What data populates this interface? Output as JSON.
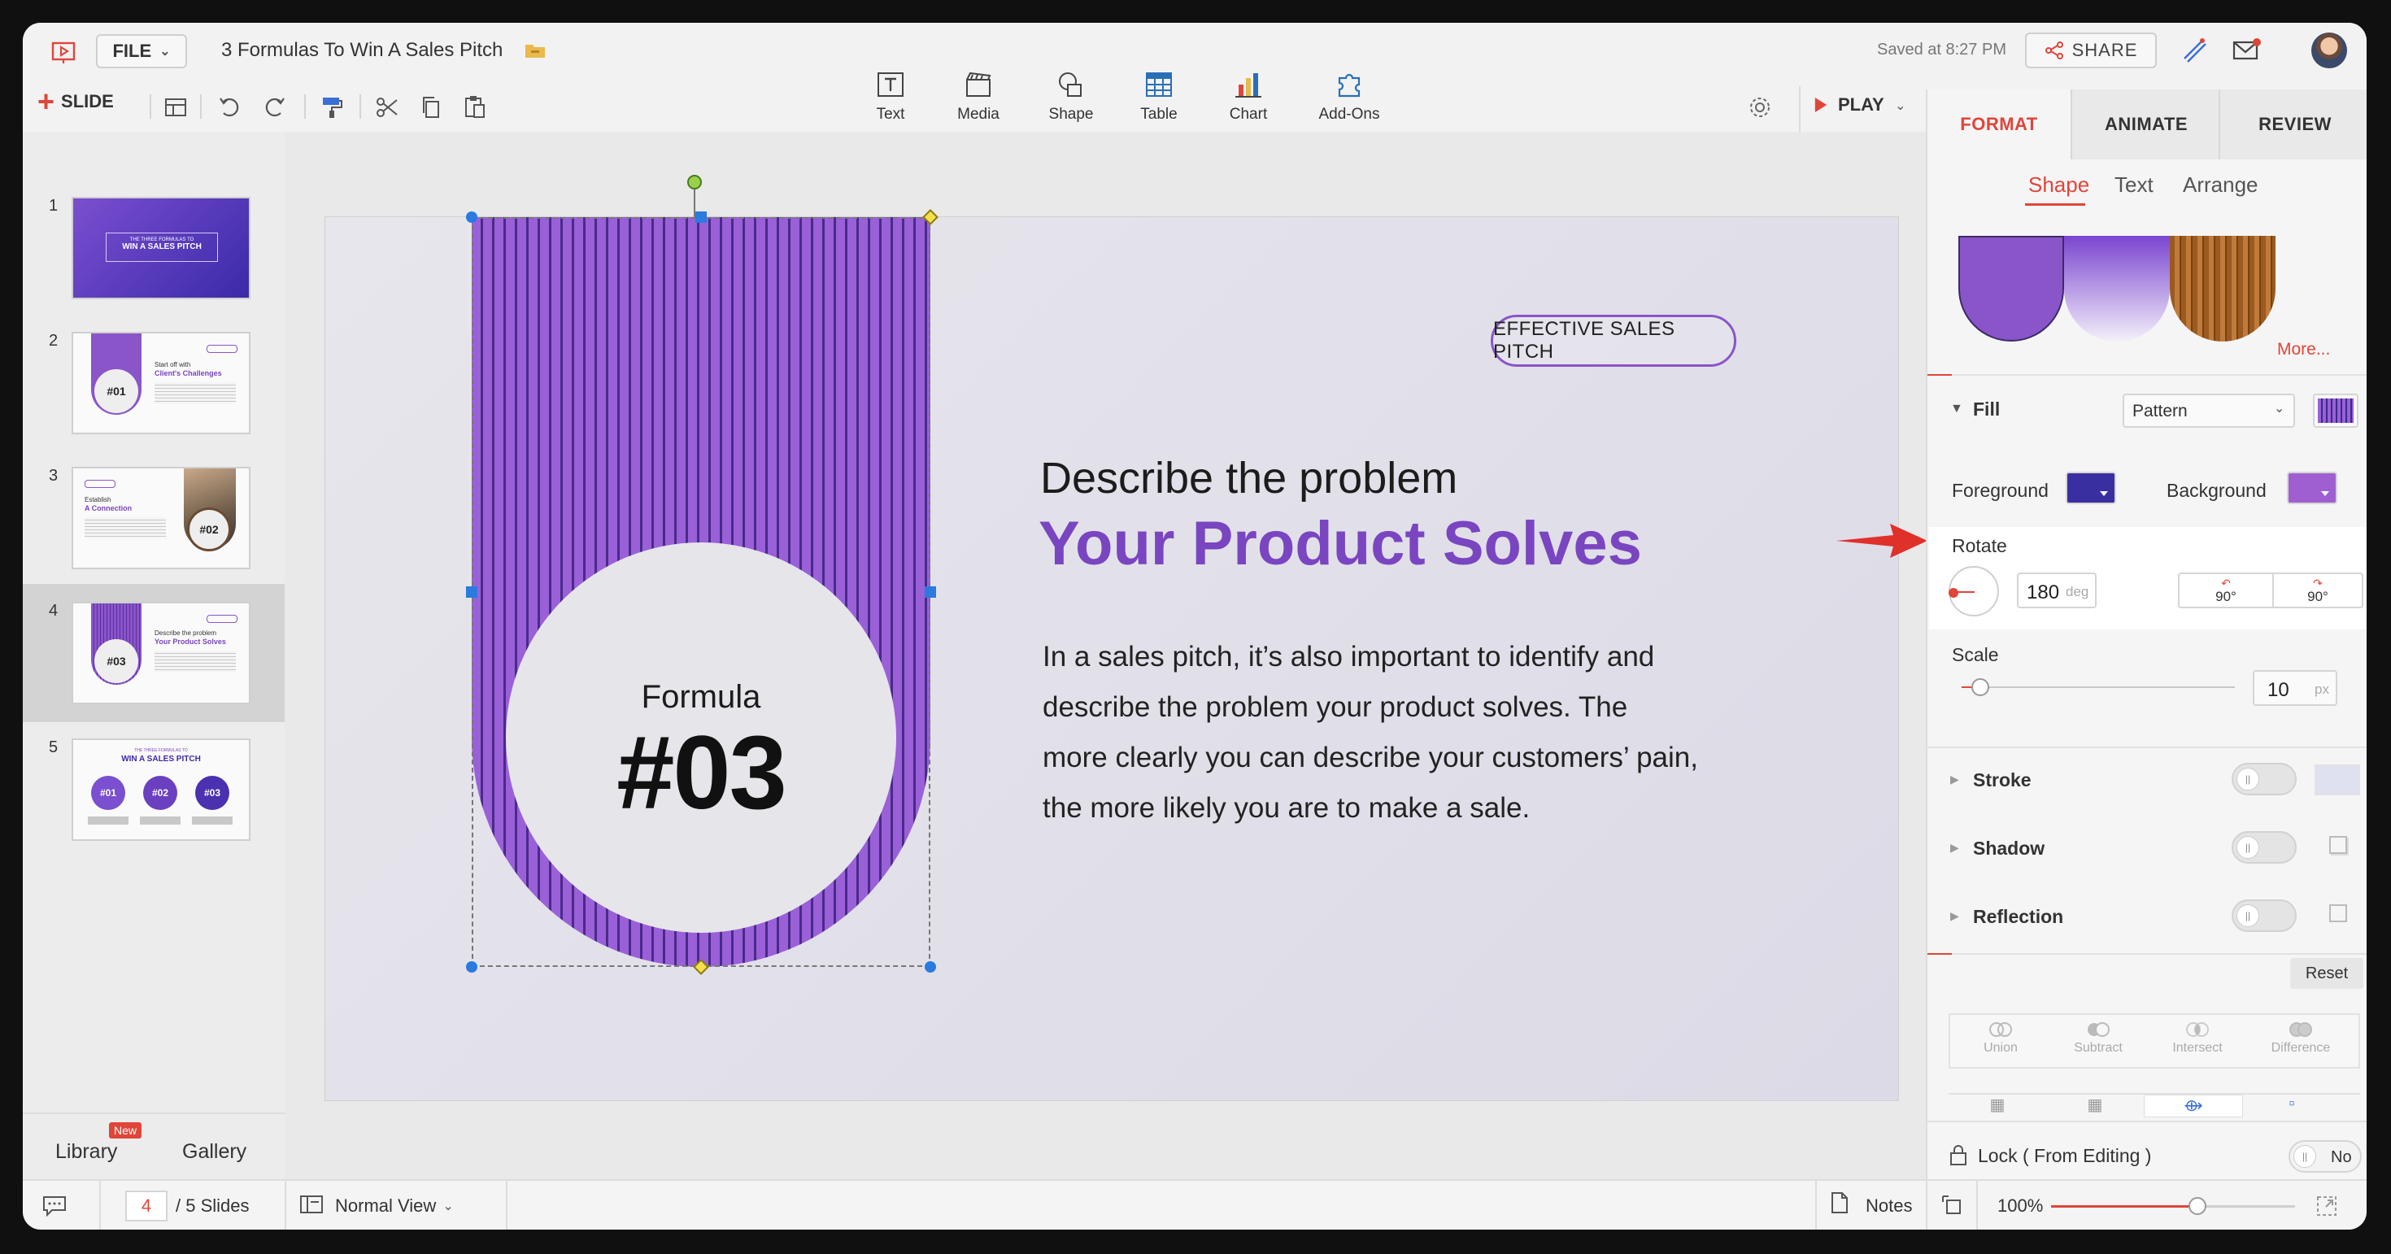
{
  "header": {
    "file_label": "FILE",
    "doc_title": "3 Formulas To Win A Sales Pitch",
    "saved_status": "Saved at 8:27 PM",
    "share_label": "SHARE",
    "play_label": "PLAY",
    "slide_label": "SLIDE"
  },
  "insert_tools": [
    {
      "label": "Text",
      "icon": "text-icon"
    },
    {
      "label": "Media",
      "icon": "media-icon"
    },
    {
      "label": "Shape",
      "icon": "shape-icon"
    },
    {
      "label": "Table",
      "icon": "table-icon"
    },
    {
      "label": "Chart",
      "icon": "chart-icon"
    },
    {
      "label": "Add-Ons",
      "icon": "addons-icon"
    }
  ],
  "slides_panel": {
    "numbers": [
      "1",
      "2",
      "3",
      "4",
      "5"
    ],
    "selected": 4,
    "thumb1": {
      "kicker": "THE THREE FORMULAS TO",
      "title": "WIN A SALES PITCH"
    },
    "thumb2": {
      "line1": "Start off with",
      "line2": "Client's Challenges",
      "badge": "#01"
    },
    "thumb3": {
      "line1": "Establish",
      "line2": "A Connection",
      "badge": "#02"
    },
    "thumb4": {
      "line1": "Describe the problem",
      "line2": "Your Product Solves",
      "badge": "#03"
    },
    "thumb5": {
      "kicker": "THE THREE FORMULAS TO",
      "title": "WIN A SALES PITCH",
      "b1": "#01",
      "b2": "#02",
      "b3": "#03"
    },
    "library_label": "Library",
    "library_badge": "New",
    "gallery_label": "Gallery"
  },
  "slide": {
    "tag": "EFFECTIVE SALES PITCH",
    "heading_line1": "Describe the problem",
    "heading_line2": "Your Product Solves",
    "body_lines": [
      "In a sales pitch, it’s also important to identify and",
      "describe the problem your product solves. The",
      "more clearly you can describe your customers’ pain,",
      "the more likely you are to make a sale."
    ],
    "formula_label": "Formula",
    "formula_number": "#03"
  },
  "format_panel": {
    "tabs": [
      "FORMAT",
      "ANIMATE",
      "REVIEW"
    ],
    "active_tab": "FORMAT",
    "subtabs": [
      "Shape",
      "Text",
      "Arrange"
    ],
    "active_subtab": "Shape",
    "more_label": "More...",
    "fill_label": "Fill",
    "fill_type": "Pattern",
    "foreground_label": "Foreground",
    "background_label": "Background",
    "rotate_label": "Rotate",
    "rotate_value": "180",
    "rotate_unit": "deg",
    "rotate_ccw": "90°",
    "rotate_cw": "90°",
    "scale_label": "Scale",
    "scale_value": "10",
    "scale_unit": "px",
    "stroke_label": "Stroke",
    "shadow_label": "Shadow",
    "reflection_label": "Reflection",
    "reset_label": "Reset",
    "bool_ops": [
      "Union",
      "Subtract",
      "Intersect",
      "Difference"
    ],
    "lock_label": "Lock ( From Editing )",
    "lock_value": "No"
  },
  "statusbar": {
    "current_slide": "4",
    "total_slides": "/ 5 Slides",
    "view_mode": "Normal View",
    "notes_label": "Notes",
    "zoom": "100%",
    "zoom_fraction": 0.6
  },
  "colors": {
    "accent_red": "#e0453a",
    "purple": "#8a55c9",
    "purple_dark": "#5b2fa0",
    "heading_purple": "#7a45c0",
    "foreground_swatch": "#3a2fa0",
    "background_swatch": "#a05fd0"
  }
}
